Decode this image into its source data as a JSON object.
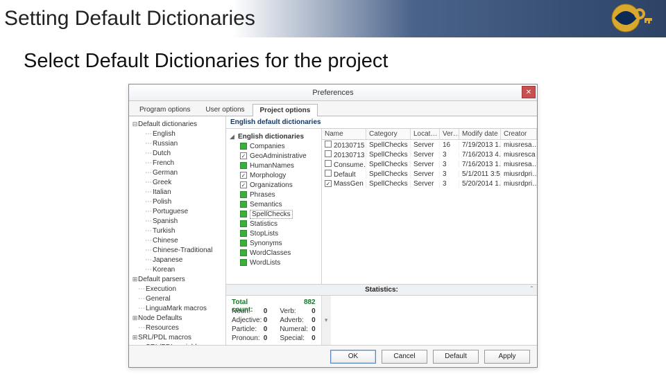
{
  "banner": {
    "title": "Setting Default Dictionaries"
  },
  "subtitle": "Select Default Dictionaries for the project",
  "dialog": {
    "title": "Preferences",
    "tabs": [
      "Program options",
      "User options",
      "Project options"
    ],
    "active_tab": 2,
    "buttons": {
      "ok": "OK",
      "cancel": "Cancel",
      "default": "Default",
      "apply": "Apply"
    }
  },
  "tree": [
    {
      "d": 0,
      "tw": "⊟",
      "label": "Default dictionaries"
    },
    {
      "d": 1,
      "tw": "",
      "dash": true,
      "label": "English"
    },
    {
      "d": 1,
      "tw": "",
      "dash": true,
      "label": "Russian"
    },
    {
      "d": 1,
      "tw": "",
      "dash": true,
      "label": "Dutch"
    },
    {
      "d": 1,
      "tw": "",
      "dash": true,
      "label": "French"
    },
    {
      "d": 1,
      "tw": "",
      "dash": true,
      "label": "German"
    },
    {
      "d": 1,
      "tw": "",
      "dash": true,
      "label": "Greek"
    },
    {
      "d": 1,
      "tw": "",
      "dash": true,
      "label": "Italian"
    },
    {
      "d": 1,
      "tw": "",
      "dash": true,
      "label": "Polish"
    },
    {
      "d": 1,
      "tw": "",
      "dash": true,
      "label": "Portuguese"
    },
    {
      "d": 1,
      "tw": "",
      "dash": true,
      "label": "Spanish"
    },
    {
      "d": 1,
      "tw": "",
      "dash": true,
      "label": "Turkish"
    },
    {
      "d": 1,
      "tw": "",
      "dash": true,
      "label": "Chinese"
    },
    {
      "d": 1,
      "tw": "",
      "dash": true,
      "label": "Chinese-Traditional"
    },
    {
      "d": 1,
      "tw": "",
      "dash": true,
      "label": "Japanese"
    },
    {
      "d": 1,
      "tw": "",
      "dash": true,
      "label": "Korean"
    },
    {
      "d": 0,
      "tw": "⊞",
      "label": "Default parsers"
    },
    {
      "d": 0,
      "tw": "",
      "dash": true,
      "label": "Execution"
    },
    {
      "d": 0,
      "tw": "",
      "dash": true,
      "label": "General"
    },
    {
      "d": 0,
      "tw": "",
      "dash": true,
      "label": "LinguaMark macros"
    },
    {
      "d": 0,
      "tw": "⊞",
      "label": "Node Defaults"
    },
    {
      "d": 0,
      "tw": "",
      "dash": true,
      "label": "Resources"
    },
    {
      "d": 0,
      "tw": "⊞",
      "label": "SRL/PDL macros"
    },
    {
      "d": 0,
      "tw": "",
      "dash": true,
      "label": "SRL/PDL variables"
    }
  ],
  "right_header": "English default dictionaries",
  "categories": {
    "root": {
      "tw": "◢",
      "label": "English dictionaries"
    },
    "items": [
      {
        "chk": "green",
        "label": "Companies"
      },
      {
        "chk": "checked",
        "label": "GeoAdministrative"
      },
      {
        "chk": "green",
        "label": "HumanNames"
      },
      {
        "chk": "checked",
        "label": "Morphology"
      },
      {
        "chk": "checked",
        "label": "Organizations"
      },
      {
        "chk": "green",
        "label": "Phrases"
      },
      {
        "chk": "green",
        "label": "Semantics"
      },
      {
        "chk": "green",
        "label": "SpellChecks",
        "sel": true
      },
      {
        "chk": "green",
        "label": "Statistics"
      },
      {
        "chk": "green",
        "label": "StopLists"
      },
      {
        "chk": "green",
        "label": "Synonyms"
      },
      {
        "chk": "green",
        "label": "WordClasses"
      },
      {
        "chk": "green",
        "label": "WordLists"
      }
    ]
  },
  "grid": {
    "headers": [
      "Name",
      "Category",
      "Locat…",
      "Ver…",
      "Modify date",
      "Creator"
    ],
    "rows": [
      {
        "chk": "",
        "cells": [
          "20130715…",
          "SpellChecks",
          "Server",
          "16",
          "7/19/2013 1…",
          "miusresa…"
        ]
      },
      {
        "chk": "",
        "cells": [
          "20130713…",
          "SpellChecks",
          "Server",
          "3",
          "7/16/2013 4…",
          "miusresca…"
        ]
      },
      {
        "chk": "",
        "cells": [
          "Consume…",
          "SpellChecks",
          "Server",
          "3",
          "7/16/2013 1…",
          "miusresa…"
        ]
      },
      {
        "chk": "",
        "cells": [
          "Default",
          "SpellChecks",
          "Server",
          "3",
          "5/1/2011 3:5…",
          "miusrdpri…"
        ]
      },
      {
        "chk": "checked",
        "cells": [
          "MassGen",
          "SpellChecks",
          "Server",
          "3",
          "5/20/2014 1…",
          "miusrdpri…"
        ]
      }
    ]
  },
  "stats": {
    "title": "Statistics:",
    "total": {
      "label": "Total count:",
      "value": "882"
    },
    "left": [
      {
        "k": "Noun:",
        "v": "0"
      },
      {
        "k": "Adjective:",
        "v": "0"
      },
      {
        "k": "Particle:",
        "v": "0"
      },
      {
        "k": "Pronoun:",
        "v": "0"
      }
    ],
    "right": [
      {
        "k": "Verb:",
        "v": "0"
      },
      {
        "k": "Adverb:",
        "v": "0"
      },
      {
        "k": "Numeral:",
        "v": "0"
      },
      {
        "k": "Special:",
        "v": "0"
      }
    ]
  }
}
